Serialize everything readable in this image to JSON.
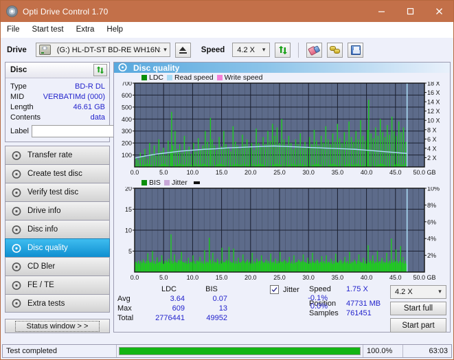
{
  "window": {
    "title": "Opti Drive Control 1.70",
    "icon": "disc-icon",
    "minimize": "minimize",
    "maximize": "maximize",
    "close": "close"
  },
  "menu": [
    {
      "label": "File"
    },
    {
      "label": "Start test"
    },
    {
      "label": "Extra"
    },
    {
      "label": "Help"
    }
  ],
  "toolbar": {
    "drive_label": "Drive",
    "drive_value": "(G:)  HL-DT-ST BD-RE  WH16NS48 1.D3",
    "eject_icon": "eject-icon",
    "speed_label": "Speed",
    "speed_value": "4.2 X",
    "refresh_icon": "refresh-icon",
    "eraser_icon": "eraser-icon",
    "plug_icon": "plug-icon",
    "save_icon": "save-icon"
  },
  "disc": {
    "panel_title": "Disc",
    "refresh_icon": "refresh-icon",
    "rows": [
      {
        "key": "Type",
        "value": "BD-R DL"
      },
      {
        "key": "MID",
        "value": "VERBATIMd (000)"
      },
      {
        "key": "Length",
        "value": "46.61 GB"
      },
      {
        "key": "Contents",
        "value": "data"
      }
    ],
    "label_key": "Label",
    "label_value": "",
    "label_placeholder": "",
    "disc_button_icon": "cd-icon"
  },
  "sidebar": {
    "items": [
      {
        "label": "Transfer rate",
        "icon": "disc-icon",
        "active": false
      },
      {
        "label": "Create test disc",
        "icon": "disc-icon",
        "active": false
      },
      {
        "label": "Verify test disc",
        "icon": "disc-icon",
        "active": false
      },
      {
        "label": "Drive info",
        "icon": "disc-icon",
        "active": false
      },
      {
        "label": "Disc info",
        "icon": "disc-icon",
        "active": false
      },
      {
        "label": "Disc quality",
        "icon": "disc-icon",
        "active": true
      },
      {
        "label": "CD Bler",
        "icon": "disc-icon",
        "active": false
      },
      {
        "label": "FE / TE",
        "icon": "disc-icon",
        "active": false
      },
      {
        "label": "Extra tests",
        "icon": "disc-icon",
        "active": false
      }
    ],
    "status_window": "Status window > >"
  },
  "content": {
    "header_title": "Disc quality",
    "header_icon": "disc-icon"
  },
  "stats": {
    "col_headers": [
      "",
      "LDC",
      "BIS"
    ],
    "rows": [
      {
        "key": "Avg",
        "ldc": "3.64",
        "bis": "0.07"
      },
      {
        "key": "Max",
        "ldc": "609",
        "bis": "13"
      },
      {
        "key": "Total",
        "ldc": "2776441",
        "bis": "49952"
      }
    ],
    "jitter": {
      "label": "Jitter",
      "checked": true,
      "avg": "-0.1%",
      "max": "0.0%"
    },
    "speed_key": "Speed",
    "speed_value": "1.75 X",
    "position_key": "Position",
    "position_value": "47731 MB",
    "samples_key": "Samples",
    "samples_value": "761451",
    "speed_select": "4.2 X",
    "start_full": "Start full",
    "start_part": "Start part"
  },
  "statusbar": {
    "message": "Test completed",
    "percent": "100.0%",
    "progress": 100,
    "time": "63:03"
  },
  "colors": {
    "titlebar": "#c37049",
    "ldc": "#1fcc1f",
    "bis": "#1fcc1f",
    "read_speed": "#aadcf5",
    "write_speed": "#f57fd8",
    "jitter": "#c9a8d8",
    "plot_bg": "#5d6b8a",
    "accent": "#2222cc",
    "progress": "#13b513"
  },
  "chart_data": [
    {
      "type": "line",
      "title": "LDC / Read speed",
      "xlabel": "GB",
      "ylabel": "LDC",
      "xlim": [
        0,
        50
      ],
      "ylim": [
        0,
        700
      ],
      "y2lim": [
        0,
        18
      ],
      "y2label": "X",
      "xticks": [
        "0.0",
        "5.0",
        "10.0",
        "15.0",
        "20.0",
        "25.0",
        "30.0",
        "35.0",
        "40.0",
        "45.0",
        "50.0 GB"
      ],
      "yticks": [
        100,
        200,
        300,
        400,
        500,
        600,
        700
      ],
      "y2ticks": [
        "2 X",
        "4 X",
        "6 X",
        "8 X",
        "10 X",
        "12 X",
        "14 X",
        "16 X",
        "18 X"
      ],
      "grid": true,
      "legend": [
        {
          "name": "LDC",
          "color": "#0a8f0a"
        },
        {
          "name": "Read speed",
          "color": "#aadcf5"
        },
        {
          "name": "Write speed",
          "color": "#f57fd8"
        }
      ],
      "series": [
        {
          "name": "LDC",
          "type": "bar",
          "color": "#1fcc1f",
          "x": [
            0.2,
            0.5,
            0.9,
            1.3,
            1.7,
            2.1,
            2.5,
            2.9,
            3.3,
            3.7,
            4.1,
            4.5,
            4.9,
            5.3,
            5.7,
            6.1,
            6.3,
            6.5,
            6.9,
            7.3,
            7.7,
            8.1,
            8.5,
            8.9,
            9.3,
            9.7,
            10.1,
            10.5,
            10.9,
            11.3,
            11.7,
            12.1,
            12.5,
            12.9,
            13.0,
            13.3,
            13.7,
            14.1,
            14.5,
            14.9,
            15.3,
            15.7,
            16.1,
            16.5,
            16.9,
            17.3,
            17.7,
            18.1,
            18.5,
            18.9,
            19.3,
            19.7,
            20.1,
            20.5,
            20.9,
            21.3,
            21.7,
            22.1,
            22.5,
            22.9,
            23.3,
            23.7,
            24.1,
            24.5,
            24.9,
            25.3,
            25.7,
            26.1,
            26.5,
            26.9,
            27.3,
            27.7,
            28.1,
            28.5,
            28.9,
            29.3,
            29.7,
            30.1,
            30.5,
            30.9,
            31.3,
            31.7,
            32.1,
            32.5,
            32.9,
            33.3,
            33.7,
            34.1,
            34.5,
            34.9,
            35.3,
            35.7,
            36.1,
            36.5,
            36.9,
            37.3,
            37.7,
            38.1,
            38.5,
            38.9,
            39.3,
            39.7,
            40.1,
            40.3,
            40.7,
            41.1,
            41.5,
            41.9,
            42.3,
            42.7,
            43.1,
            43.5,
            43.9,
            44.3,
            44.7,
            45.1,
            45.5,
            45.9,
            46.3,
            46.7
          ],
          "values": [
            80,
            60,
            120,
            90,
            150,
            70,
            200,
            110,
            180,
            95,
            230,
            130,
            160,
            100,
            220,
            140,
            460,
            180,
            300,
            150,
            190,
            120,
            260,
            140,
            170,
            110,
            200,
            130,
            240,
            150,
            180,
            300,
            210,
            160,
            410,
            230,
            180,
            140,
            250,
            170,
            300,
            190,
            160,
            130,
            340,
            210,
            180,
            150,
            270,
            190,
            230,
            160,
            200,
            140,
            320,
            200,
            170,
            250,
            190,
            300,
            220,
            360,
            260,
            330,
            200,
            400,
            230,
            180,
            260,
            200,
            150,
            230,
            190,
            280,
            170,
            210,
            160,
            250,
            190,
            310,
            220,
            180,
            260,
            200,
            340,
            230,
            190,
            280,
            210,
            360,
            240,
            200,
            290,
            220,
            380,
            250,
            210,
            300,
            230,
            390,
            260,
            220,
            310,
            560,
            280,
            240,
            330,
            260,
            400,
            290,
            250,
            350,
            270,
            420,
            300,
            260,
            380,
            290,
            330,
            210
          ]
        },
        {
          "name": "Read speed",
          "type": "line",
          "color": "#aadcf5",
          "x": [
            0,
            2,
            4,
            6,
            8,
            10,
            12,
            14,
            16,
            18,
            20,
            22,
            24,
            26,
            28,
            30,
            32,
            34,
            36,
            38,
            40,
            42,
            44,
            46,
            47
          ],
          "values": [
            1.9,
            2.4,
            2.8,
            3.1,
            3.4,
            3.6,
            3.8,
            3.9,
            4.1,
            4.2,
            4.3,
            4.4,
            4.5,
            4.4,
            4.3,
            4.2,
            4.1,
            4.0,
            3.9,
            3.8,
            3.6,
            3.4,
            3.2,
            3.0,
            2.9
          ]
        }
      ],
      "markers": [
        {
          "name": "position-marker",
          "x": 47.0,
          "color": "#aadcf5"
        }
      ]
    },
    {
      "type": "line",
      "title": "BIS / Jitter",
      "xlabel": "GB",
      "ylabel": "BIS",
      "xlim": [
        0,
        50
      ],
      "ylim": [
        0,
        20
      ],
      "y2lim": [
        0,
        10
      ],
      "y2label": "%",
      "xticks": [
        "0.0",
        "5.0",
        "10.0",
        "15.0",
        "20.0",
        "25.0",
        "30.0",
        "35.0",
        "40.0",
        "45.0",
        "50.0 GB"
      ],
      "yticks": [
        5,
        10,
        15,
        20
      ],
      "y2ticks": [
        "2%",
        "4%",
        "6%",
        "8%",
        "10%"
      ],
      "grid": true,
      "legend": [
        {
          "name": "BIS",
          "color": "#0a8f0a"
        },
        {
          "name": "Jitter",
          "color": "#c9a8d8"
        }
      ],
      "series": [
        {
          "name": "BIS",
          "type": "bar",
          "color": "#1fcc1f",
          "x": [
            0.2,
            0.6,
            1.0,
            1.4,
            1.8,
            2.2,
            2.6,
            3.0,
            3.4,
            3.8,
            4.2,
            4.6,
            5.0,
            5.4,
            5.8,
            6.2,
            6.4,
            6.8,
            7.2,
            7.6,
            8.0,
            8.4,
            8.8,
            9.2,
            9.6,
            10.0,
            10.4,
            10.8,
            11.2,
            11.6,
            12.0,
            12.4,
            12.8,
            13.0,
            13.4,
            13.8,
            14.2,
            14.6,
            15.0,
            15.4,
            15.8,
            16.2,
            16.6,
            17.0,
            17.4,
            17.8,
            18.2,
            18.6,
            19.0,
            19.4,
            19.8,
            20.2,
            20.6,
            21.0,
            21.4,
            21.8,
            22.2,
            22.6,
            23.0,
            23.4,
            23.8,
            24.2,
            24.6,
            25.0,
            25.4,
            25.8,
            26.2,
            26.6,
            27.0,
            27.4,
            27.8,
            28.2,
            28.6,
            29.0,
            29.4,
            29.8,
            30.2,
            30.6,
            31.0,
            31.4,
            31.8,
            32.2,
            32.6,
            33.0,
            33.4,
            33.8,
            34.2,
            34.6,
            35.0,
            35.4,
            35.8,
            36.2,
            36.6,
            37.0,
            37.4,
            37.8,
            38.2,
            38.6,
            39.0,
            39.4,
            39.8,
            40.2,
            40.6,
            41.0,
            41.4,
            41.8,
            42.2,
            42.6,
            43.0,
            43.4,
            43.8,
            44.2,
            44.6,
            45.0,
            45.4,
            45.8,
            46.2,
            46.6
          ],
          "values": [
            1.5,
            2.0,
            1.2,
            3.0,
            1.8,
            4.5,
            2.2,
            5.0,
            1.6,
            3.5,
            2.4,
            4.0,
            1.8,
            2.8,
            3.2,
            9.0,
            2.0,
            4.2,
            1.6,
            3.0,
            4.8,
            2.2,
            1.8,
            3.4,
            2.0,
            4.0,
            1.6,
            2.8,
            3.6,
            2.2,
            5.2,
            1.8,
            8.2,
            3.0,
            4.6,
            2.0,
            3.2,
            1.6,
            5.8,
            2.4,
            3.0,
            6.0,
            2.0,
            5.6,
            2.6,
            3.4,
            1.8,
            4.2,
            2.2,
            3.0,
            1.6,
            4.6,
            2.0,
            3.2,
            2.6,
            4.0,
            1.8,
            3.0,
            2.2,
            4.4,
            1.6,
            3.2,
            2.0,
            4.8,
            2.4,
            3.0,
            1.8,
            3.6,
            2.2,
            4.0,
            1.6,
            3.0,
            2.4,
            4.2,
            2.0,
            3.4,
            1.8,
            4.6,
            2.2,
            3.0,
            1.6,
            3.8,
            2.4,
            4.0,
            2.0,
            3.2,
            1.8,
            4.4,
            2.2,
            3.0,
            1.6,
            3.6,
            2.4,
            4.8,
            2.0,
            3.0,
            1.8,
            4.2,
            2.2,
            3.4,
            1.6,
            6.4,
            3.0,
            4.0,
            2.2,
            5.0,
            2.6,
            3.4,
            1.8,
            4.6,
            2.4,
            8.0,
            3.0,
            5.4,
            2.2,
            6.2,
            3.6,
            2.0
          ]
        }
      ],
      "markers": [
        {
          "name": "position-marker",
          "x": 47.0,
          "color": "#aadcf5"
        }
      ]
    }
  ]
}
